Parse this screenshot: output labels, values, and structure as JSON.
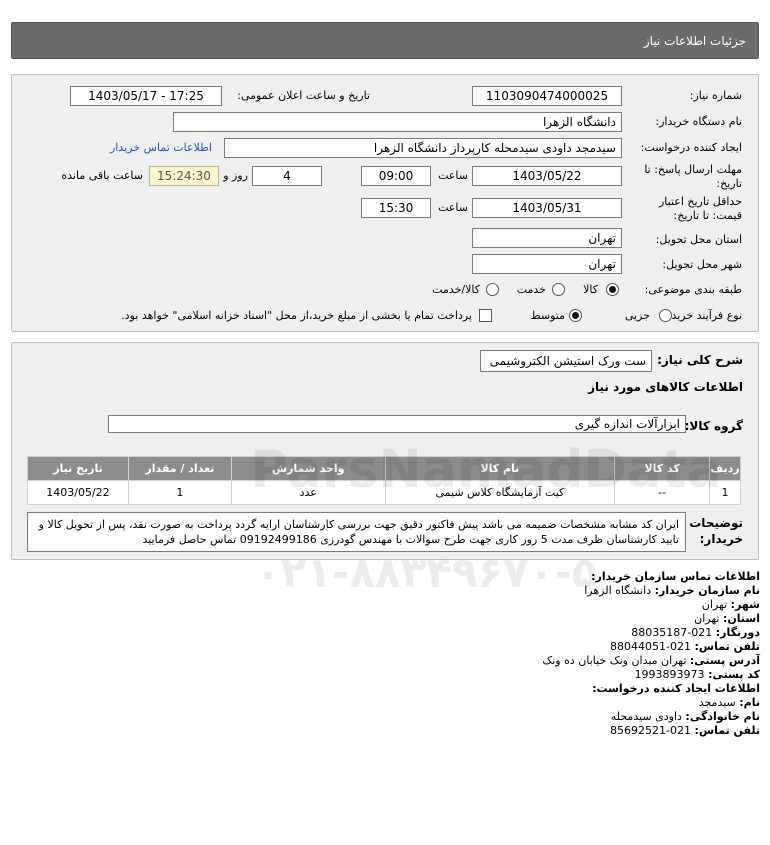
{
  "header": {
    "title": "جزئیات اطلاعات نیاز"
  },
  "form": {
    "need_number_label": "شماره نیاز:",
    "need_number": "1103090474000025",
    "announce_label": "تاریخ و ساعت اعلان عمومی:",
    "announce_value": "1403/05/17 - 17:25",
    "buyer_label": "نام دستگاه خریدار:",
    "buyer_value": "دانشگاه الزهرا",
    "creator_label": "ایجاد کننده درخواست:",
    "creator_value": "سیدمجد داودی سیدمحله کارپرداز دانشگاه الزهرا",
    "contact_link": "اطلاعات تماس خریدار",
    "deadline_label_1": "مهلت ارسال پاسخ: تا",
    "deadline_label_2": "تاریخ:",
    "deadline_date": "1403/05/22",
    "time_label": "ساعت",
    "deadline_time": "09:00",
    "days_value": "4",
    "days_label": "روز و",
    "remaining_time": "15:24:30",
    "remaining_label": "ساعت باقی مانده",
    "validity_label_1": "حداقل تاریخ اعتبار",
    "validity_label_2": "قیمت: تا تاریخ:",
    "validity_date": "1403/05/31",
    "validity_time_label": "ساعت",
    "validity_time": "15:30",
    "province_label": "استان محل تحویل:",
    "province_value": "تهران",
    "city_label": "شهر محل تحویل:",
    "city_value": "تهران",
    "category_label": "طبقه بندی موضوعی:",
    "category_options": [
      "کالا",
      "خدمت",
      "کالا/خدمت"
    ],
    "process_label": "نوع فرآیند خرید :",
    "process_options": [
      "جزیی",
      "متوسط"
    ],
    "payment_note": "پرداخت تمام یا بخشی از مبلغ خرید،از محل \"اسناد خزانه اسلامی\" خواهد بود."
  },
  "need": {
    "summary_label": "شرح کلی نیاز:",
    "summary_value": "ست ورک استیشن الکتروشیمی",
    "goods_title": "اطلاعات کالاهای مورد نیاز",
    "group_label": "گروه کالا:",
    "group_value": "ابزارآلات اندازه گیری",
    "table": {
      "headers": [
        "ردیف",
        "کد کالا",
        "نام کالا",
        "واحد شمارش",
        "تعداد / مقدار",
        "تاریخ نیاز"
      ],
      "rows": [
        [
          "1",
          "--",
          "کیت آزمایشگاه کلاس شیمی",
          "عدد",
          "1",
          "1403/05/22"
        ]
      ]
    },
    "desc_label_1": "توضیحات",
    "desc_label_2": "خریدار:",
    "desc_value": "ایران کد مشابه مشخصات ضمیمه می باشد پیش فاکتور دقیق جهت بررسی کارشناسان ارایه گردد پرداخت به صورت نقد، پس از تحویل کالا و تایید کارشناسان ظرف مدت 5 روز کاری جهت طرح سوالات با مهندس گودرزی 09192499186 تماس حاصل فرمایید"
  },
  "contact": {
    "title": "اطلاعات تماس سازمان خریدار:",
    "org_label": "نام سازمان خریدار:",
    "org_value": "دانشگاه الزهرا",
    "city_label": "شهر:",
    "city_value": "تهران",
    "province_label": "استان:",
    "province_value": "تهران",
    "fax_label": "دورنگار:",
    "fax_value": "021-88035187",
    "phone_label": "تلفن تماس:",
    "phone_value": "021-88044051",
    "address_label": "آدرس پستی:",
    "address_value": "تهران میدان ونک خیابان ده ونک",
    "postal_label": "کد پستی:",
    "postal_value": "1993893973",
    "creator_title": "اطلاعات ایجاد کننده درخواست:",
    "first_label": "نام:",
    "first_value": "سیدمجد",
    "last_label": "نام خانوادگی:",
    "last_value": "داودی سیدمحله",
    "creator_phone_label": "تلفن تماس:",
    "creator_phone_value": "021-85692521"
  },
  "watermark": {
    "line1": "ParsNamadData",
    "line2": "۰۲۱-۸۸۳۴۹۶۷۰-۵"
  }
}
